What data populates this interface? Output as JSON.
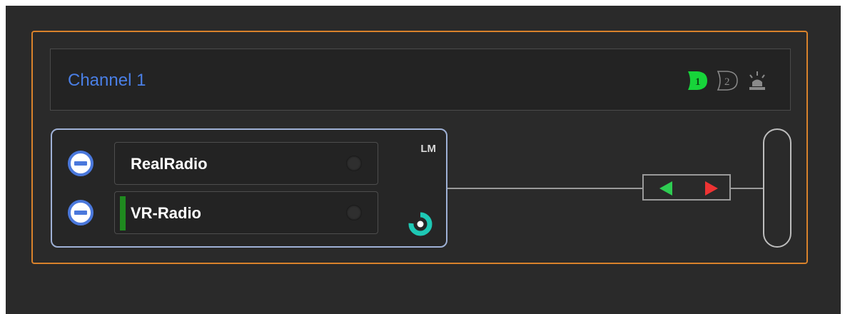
{
  "channel": {
    "title": "Channel 1"
  },
  "header_icons": [
    {
      "name": "select-1-icon",
      "label": "1",
      "color": "#17d43a",
      "active": true
    },
    {
      "name": "select-2-icon",
      "label": "2",
      "color": "#8a8a8a",
      "active": false
    },
    {
      "name": "alarm-light-icon",
      "color": "#8a8a8a"
    }
  ],
  "sources": {
    "badge": "LM",
    "items": [
      {
        "label": "RealRadio",
        "level": 0,
        "led_color": "#2f2f2f"
      },
      {
        "label": "VR-Radio",
        "level": 1,
        "level_color": "#1f8a1f",
        "led_color": "#2f2f2f"
      }
    ]
  },
  "transfer": {
    "left_arrow_color": "#2ecc52",
    "right_arrow_color": "#ee3333"
  },
  "colors": {
    "panel_border": "#d9822b",
    "title": "#4a7fe6",
    "minus_button": "#4a78dc",
    "spinner": "#1ec8b4"
  }
}
